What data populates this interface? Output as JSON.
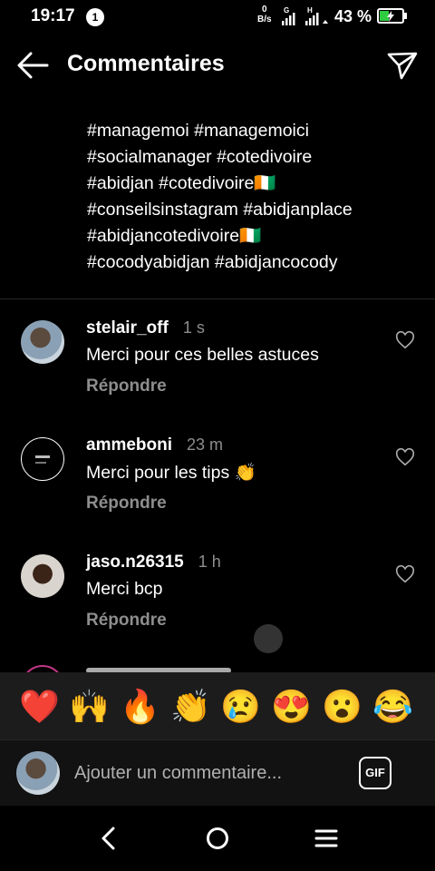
{
  "status_bar": {
    "time": "19:17",
    "notification_badge": "1",
    "speed_value": "0",
    "speed_unit": "B/s",
    "network_1": "G",
    "network_2": "H",
    "battery_percent": "43 %",
    "battery_level": 0.43
  },
  "header": {
    "title": "Commentaires"
  },
  "caption": {
    "lines": [
      "#managemoi #managemoici",
      "#socialmanager #cotedivoire",
      "#abidjan #cotedivoire🇨🇮",
      "#conseilsinstagram #abidjanplace",
      "#abidjancotedivoire🇨🇮",
      "#cocodyabidjan #abidjancocody"
    ]
  },
  "comments": [
    {
      "username": "stelair_off",
      "time": "1 s",
      "text": "Merci pour ces belles astuces",
      "reply": "Répondre"
    },
    {
      "username": "ammeboni",
      "time": "23 m",
      "text": "Merci pour les tips 👏",
      "reply": "Répondre"
    },
    {
      "username": "jaso.n26315",
      "time": "1 h",
      "text": "Merci bcp",
      "reply": "Répondre"
    }
  ],
  "emoji_reactions": [
    "❤️",
    "🙌",
    "🔥",
    "👏",
    "😢",
    "😍",
    "😮",
    "😂"
  ],
  "input": {
    "placeholder": "Ajouter un commentaire...",
    "gif_label": "GIF"
  },
  "icons": {
    "back": "arrow-left-icon",
    "share": "paper-plane-icon",
    "like": "heart-outline-icon",
    "nav_back": "chevron-left-icon",
    "nav_home": "circle-home-icon",
    "nav_menu": "menu-icon"
  },
  "colors": {
    "background": "#000000",
    "muted_text": "#8e8e8e",
    "battery_fill": "#2ecc40",
    "emoji_bar": "#1c1c1c"
  }
}
